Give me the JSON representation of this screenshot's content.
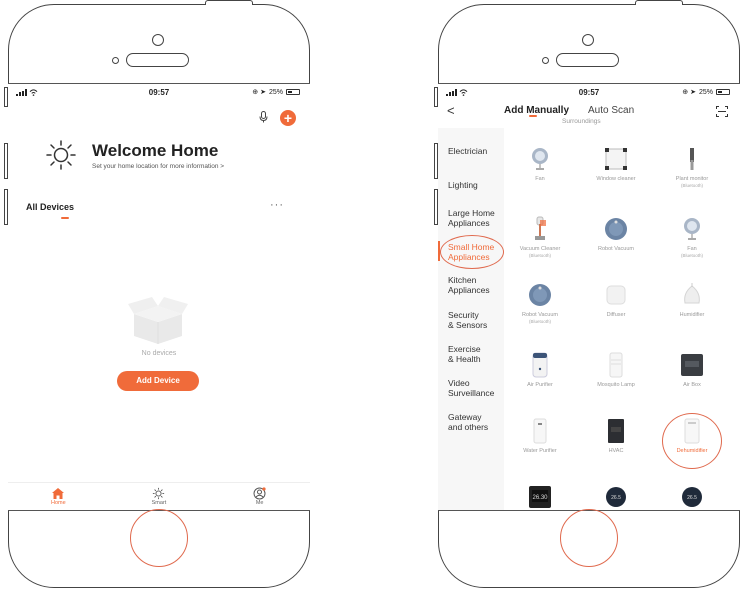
{
  "colors": {
    "accent": "#f06b3a",
    "annotation": "#e06a4e"
  },
  "left_screen": {
    "status": {
      "time": "09:57",
      "battery": "25%"
    },
    "header": {
      "mic_icon": "microphone-icon",
      "add_icon": "plus-icon"
    },
    "home": {
      "icon": "sun-icon",
      "title": "Welcome Home",
      "subtitle": "Set your home location for more information",
      "subtitle_arrow": ">"
    },
    "section": {
      "title": "All Devices",
      "more": "···"
    },
    "empty": {
      "icon": "empty-box-icon",
      "text": "No devices"
    },
    "add_button": "Add Device",
    "tabbar": [
      {
        "label": "Home",
        "icon": "home-icon",
        "active": true
      },
      {
        "label": "Smart",
        "icon": "sun-icon",
        "active": false
      },
      {
        "label": "Me",
        "icon": "profile-icon",
        "active": false
      }
    ]
  },
  "right_screen": {
    "status": {
      "time": "09:57",
      "battery": "25%"
    },
    "nav": {
      "back": "<",
      "tab_manual": "Add Manually",
      "tab_auto": "Auto Scan",
      "scan_icon": "scan-icon"
    },
    "section_header": "Surroundings",
    "categories": [
      {
        "label1": "Electrician",
        "label2": ""
      },
      {
        "label1": "Lighting",
        "label2": ""
      },
      {
        "label1": "Large Home",
        "label2": "Appliances"
      },
      {
        "label1": "Small Home",
        "label2": "Appliances"
      },
      {
        "label1": "Kitchen",
        "label2": "Appliances"
      },
      {
        "label1": "Security",
        "label2": "& Sensors"
      },
      {
        "label1": "Exercise",
        "label2": "& Health"
      },
      {
        "label1": "Video",
        "label2": "Surveillance"
      },
      {
        "label1": "Gateway",
        "label2": "and others"
      }
    ],
    "active_category": "Small Home Appliances",
    "devices": [
      {
        "name": "Fan",
        "sub": "",
        "icon": "fan-icon"
      },
      {
        "name": "Window cleaner",
        "sub": "",
        "icon": "window-cleaner-icon"
      },
      {
        "name": "Plant monitor",
        "sub": "(Bluetooth)",
        "icon": "plant-monitor-icon"
      },
      {
        "name": "Vacuum Cleaner",
        "sub": "(Bluetooth)",
        "icon": "vacuum-cleaner-icon"
      },
      {
        "name": "Robot Vacuum",
        "sub": "",
        "icon": "robot-vacuum-icon"
      },
      {
        "name": "Fan",
        "sub": "(Bluetooth)",
        "icon": "fan-icon"
      },
      {
        "name": "Robot Vacuum",
        "sub": "(Bluetooth)",
        "icon": "robot-vacuum-icon"
      },
      {
        "name": "Diffuser",
        "sub": "",
        "icon": "diffuser-icon"
      },
      {
        "name": "Humidifier",
        "sub": "",
        "icon": "humidifier-icon"
      },
      {
        "name": "Air Purifier",
        "sub": "",
        "icon": "air-purifier-icon"
      },
      {
        "name": "Mosquito Lamp",
        "sub": "",
        "icon": "mosquito-lamp-icon"
      },
      {
        "name": "Air Box",
        "sub": "",
        "icon": "air-box-icon"
      },
      {
        "name": "Water Purifier",
        "sub": "",
        "icon": "water-purifier-icon"
      },
      {
        "name": "HVAC",
        "sub": "",
        "icon": "hvac-icon"
      },
      {
        "name": "Dehumidifier",
        "sub": "",
        "icon": "dehumidifier-icon"
      },
      {
        "name": "",
        "sub": "",
        "icon": "thermostat-icon",
        "display": "26.30"
      },
      {
        "name": "",
        "sub": "",
        "icon": "thermostat-round-icon",
        "display": "26.5"
      },
      {
        "name": "",
        "sub": "",
        "icon": "thermostat-round-icon",
        "display": "26.5"
      }
    ],
    "highlighted_device": "Dehumidifier"
  }
}
